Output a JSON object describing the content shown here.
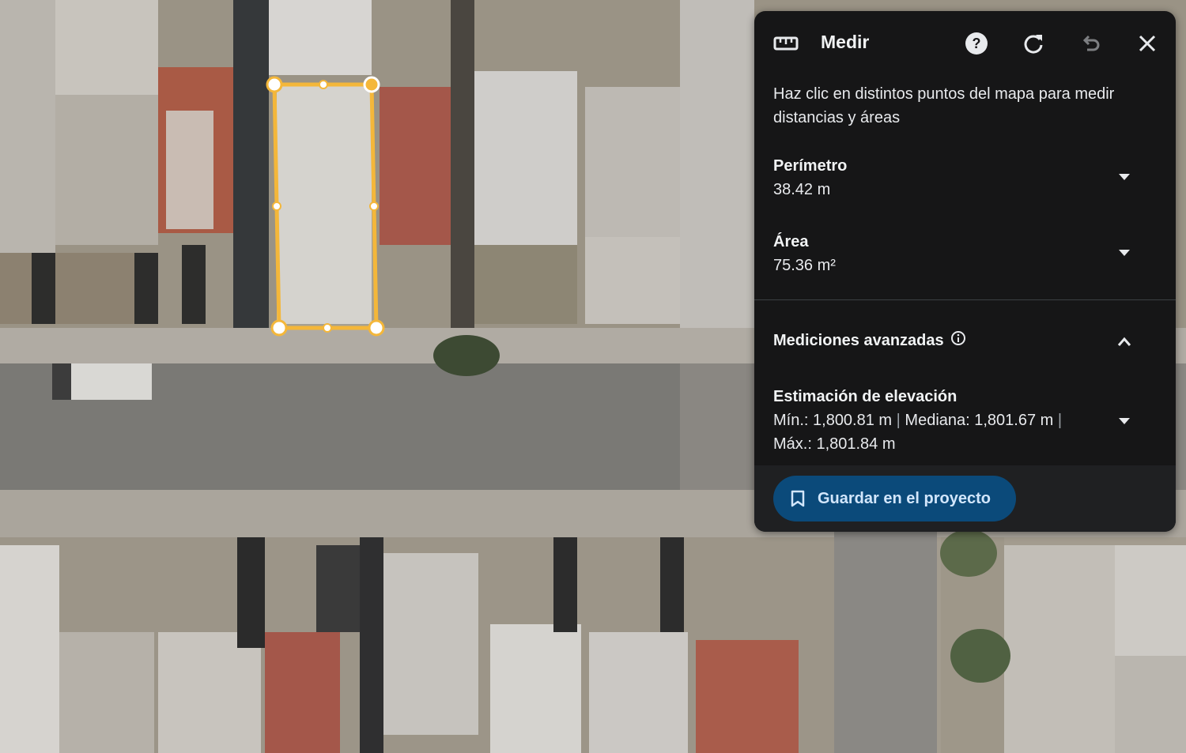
{
  "panel": {
    "title": "Medir",
    "description": "Haz clic en distintos puntos del mapa para medir distancias y áreas",
    "perimeter": {
      "label": "Perímetro",
      "value": "38.42 m"
    },
    "area": {
      "label": "Área",
      "value": "75.36 m²"
    },
    "advanced": {
      "label": "Mediciones avanzadas"
    },
    "elevation": {
      "label": "Estimación de elevación",
      "min": "Mín.: 1,800.81 m",
      "median": "Mediana: 1,801.67 m",
      "max": "Máx.: 1,801.84 m",
      "separator": "|"
    },
    "save_label": "Guardar en el proyecto"
  },
  "icons": [
    "ruler-icon",
    "help-icon",
    "refresh-icon",
    "undo-icon",
    "close-icon",
    "chevron-down-icon",
    "chevron-up-icon",
    "info-icon",
    "bookmark-icon"
  ],
  "colors": {
    "panel_bg": "#161617",
    "measure_line": "#f4b73a",
    "save_button_bg": "#0b4a7a",
    "save_button_text": "#d2e6fc"
  }
}
